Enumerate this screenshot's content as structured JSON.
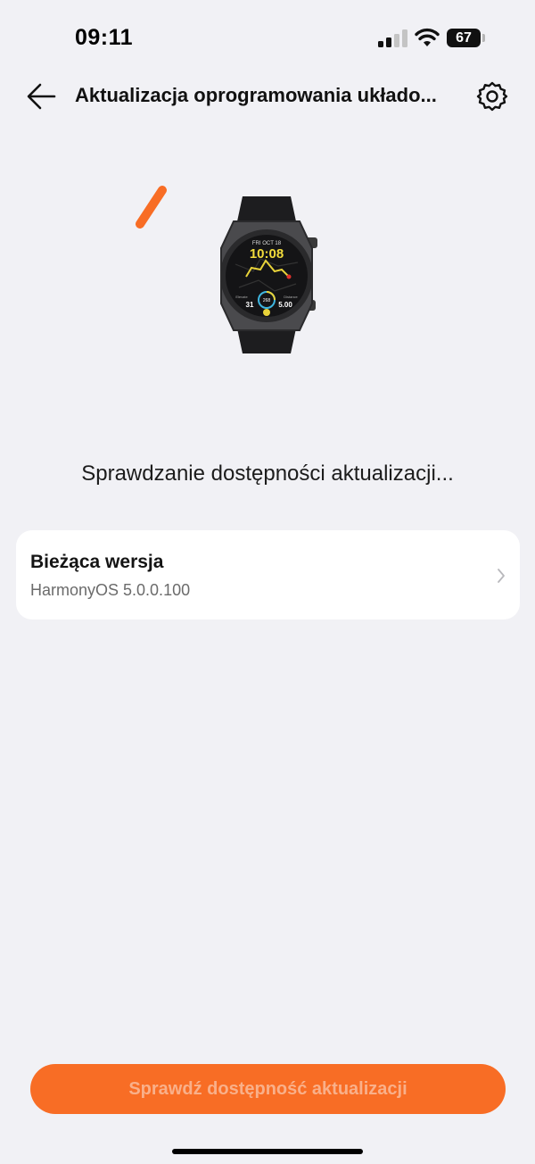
{
  "status_bar": {
    "time": "09:11",
    "battery": "67",
    "signal_icon": "cellular-signal-icon",
    "wifi_icon": "wifi-icon"
  },
  "header": {
    "title": "Aktualizacja oprogramowania układo...",
    "back_icon": "arrow-left-icon",
    "settings_icon": "gear-icon"
  },
  "watch_face": {
    "date": "FRI OCT 18",
    "time": "10:08",
    "center_value": "268",
    "left_value": "31",
    "right_value": "5.00",
    "left_label": "Elevate",
    "right_label": "Distance"
  },
  "status_message": "Sprawdzanie dostępności aktualizacji...",
  "current_version": {
    "label": "Bieżąca wersja",
    "value": "HarmonyOS 5.0.0.100"
  },
  "check_button": {
    "label": "Sprawdź dostępność aktualizacji"
  },
  "colors": {
    "accent": "#f86d25",
    "background": "#f1f1f5",
    "card": "#ffffff"
  }
}
